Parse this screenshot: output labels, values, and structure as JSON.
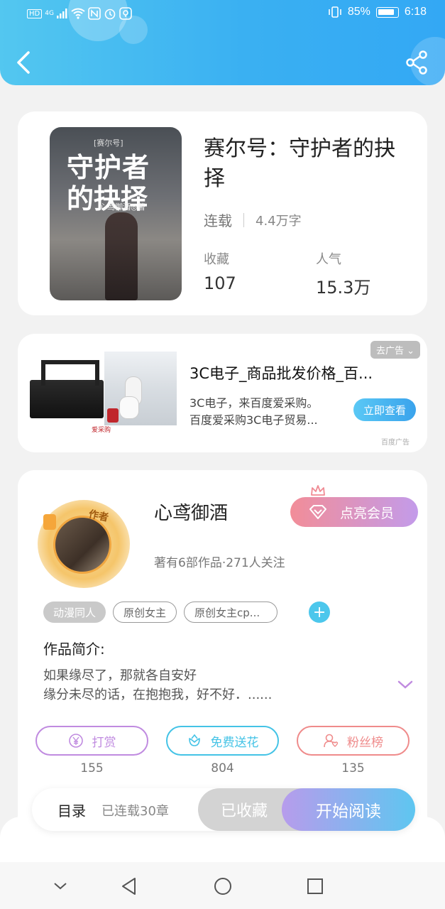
{
  "status_bar": {
    "left_icons": [
      "HD",
      "4G"
    ],
    "battery": "85%",
    "time": "6:18"
  },
  "icons": {
    "back": "back-arrow-icon",
    "share": "share-icon"
  },
  "book": {
    "cover": {
      "series": "[赛尔号]",
      "line1": "守护者",
      "line2": "的抉择",
      "author": "心鸢御酒◎著"
    },
    "title": "赛尔号：守护者的抉择",
    "state": "连载",
    "words": "4.4万字",
    "collect_label": "收藏",
    "collect_value": "107",
    "popularity_label": "人气",
    "popularity_value": "15.3万"
  },
  "ad": {
    "remove_label": "去广告",
    "title": "3C电子_商品批发价格_百...",
    "desc_line1": "3C电子，来百度爱采购。",
    "desc_line2": "百度爱采购3C电子贸易...",
    "button": "立即查看",
    "source": "百度广告",
    "img_logo": "爱采购"
  },
  "author": {
    "badge": "作者",
    "name": "心鸢御酒",
    "info": "著有6部作品·271人关注",
    "vip_button": "点亮会员"
  },
  "tags": [
    "动漫同人",
    "原创女主",
    "原创女主cp..."
  ],
  "intro": {
    "heading": "作品简介:",
    "text": "如果缘尽了，那就各自安好\n缘分未尽的话，在抱抱我，好不好．......"
  },
  "actions": [
    {
      "label": "打赏",
      "count": "155",
      "color": "#c08be0",
      "icon": "yen-icon"
    },
    {
      "label": "免费送花",
      "count": "804",
      "color": "#44c3e6",
      "icon": "flower-icon"
    },
    {
      "label": "粉丝榜",
      "count": "135",
      "color": "#ef8b8b",
      "icon": "fan-icon"
    }
  ],
  "read_bar": {
    "toc": "目录",
    "chapters": "已连载30章",
    "collected": "已收藏",
    "start": "开始阅读"
  }
}
